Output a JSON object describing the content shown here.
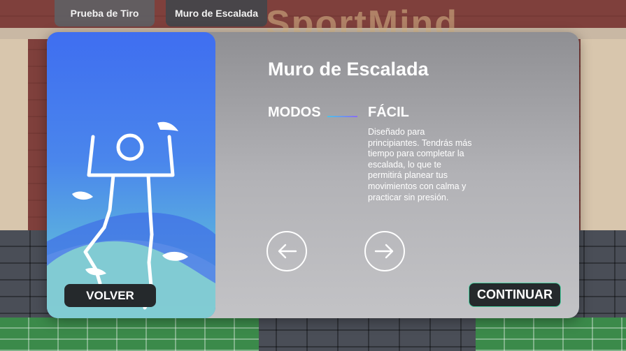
{
  "tabs": [
    {
      "label": "Prueba de Tiro",
      "active": false
    },
    {
      "label": "Muro de Escalada",
      "active": true
    }
  ],
  "background": {
    "sign_text": "SportMind"
  },
  "panel": {
    "title": "Muro de Escalada",
    "modes_label": "MODOS",
    "mode": {
      "name": "FÁCIL",
      "description": "Diseñado para principiantes. Tendrás más tiempo para completar la escalada, lo que te permitirá planear tus movimientos con calma y practicar sin presión."
    },
    "prev_icon": "arrow-left-icon",
    "next_icon": "arrow-right-icon"
  },
  "buttons": {
    "back_label": "VOLVER",
    "continue_label": "CONTINUAR"
  },
  "colors": {
    "accent_green": "#4fd3a4",
    "side_gradient_top": "#3f6ef0",
    "side_gradient_bottom": "#6fd2cc"
  }
}
